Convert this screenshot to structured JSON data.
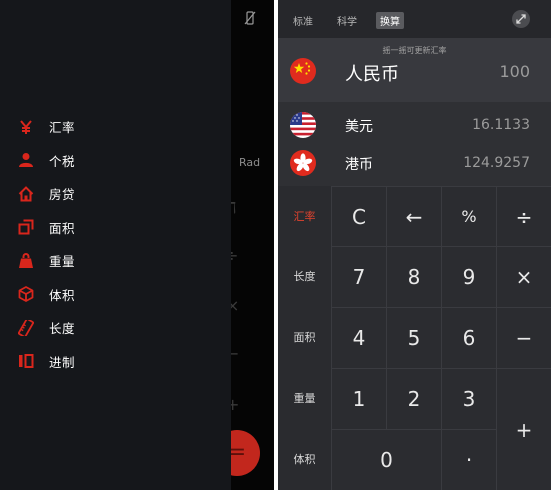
{
  "left_screen": {
    "menu": [
      {
        "label": "汇率",
        "icon": "yen-icon"
      },
      {
        "label": "个税",
        "icon": "person-icon"
      },
      {
        "label": "房贷",
        "icon": "house-icon"
      },
      {
        "label": "面积",
        "icon": "area-icon"
      },
      {
        "label": "重量",
        "icon": "weight-icon"
      },
      {
        "label": "体积",
        "icon": "cube-icon"
      },
      {
        "label": "长度",
        "icon": "ruler-icon"
      },
      {
        "label": "进制",
        "icon": "number-base-icon"
      }
    ],
    "behind": {
      "rad_label": "Rad",
      "fab_symbol": "="
    },
    "accent_color": "#d9261c"
  },
  "right_screen": {
    "tabs": [
      {
        "label": "标准",
        "active": false
      },
      {
        "label": "科学",
        "active": false
      },
      {
        "label": "换算",
        "active": true
      }
    ],
    "hint": "摇一摇可更新汇率",
    "currencies": [
      {
        "name": "人民币",
        "value": "100",
        "flag": "china-flag-icon"
      },
      {
        "name": "美元",
        "value": "16.1133",
        "flag": "usa-flag-icon"
      },
      {
        "name": "港币",
        "value": "124.9257",
        "flag": "hong-kong-flag-icon"
      }
    ],
    "units": [
      {
        "label": "汇率",
        "active": true
      },
      {
        "label": "长度",
        "active": false
      },
      {
        "label": "面积",
        "active": false
      },
      {
        "label": "重量",
        "active": false
      },
      {
        "label": "体积",
        "active": false
      }
    ],
    "keys": {
      "clear": "C",
      "backspace": "←",
      "percent": "%",
      "divide": "÷",
      "seven": "7",
      "eight": "8",
      "nine": "9",
      "multiply": "×",
      "four": "4",
      "five": "5",
      "six": "6",
      "minus": "−",
      "one": "1",
      "two": "2",
      "three": "3",
      "plus": "+",
      "zero": "0",
      "dot": "·"
    }
  }
}
